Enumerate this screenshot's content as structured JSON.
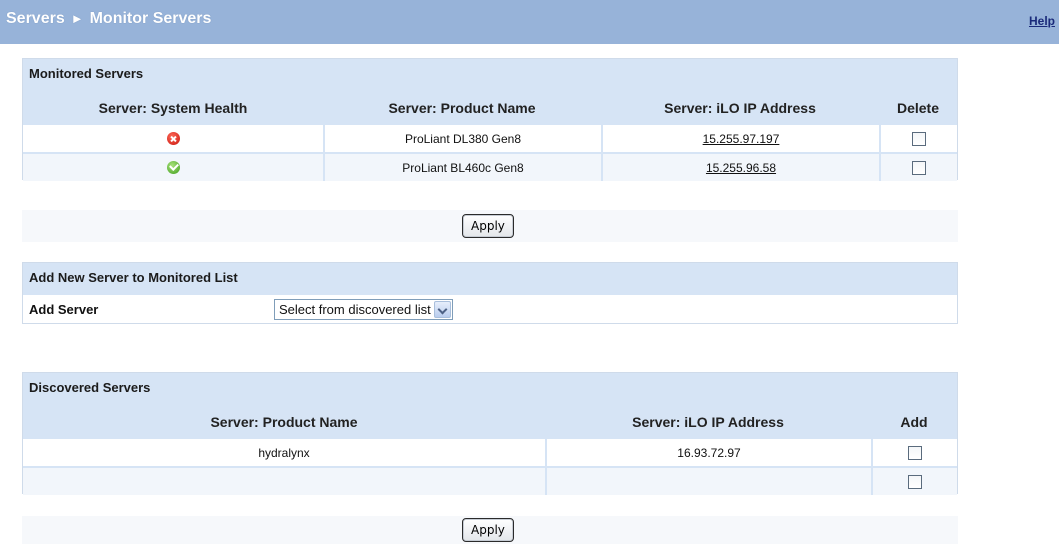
{
  "header": {
    "breadcrumb_root": "Servers",
    "breadcrumb_sep": "►",
    "breadcrumb_page": "Monitor Servers",
    "help_link": "Help"
  },
  "monitored": {
    "title": "Monitored Servers",
    "columns": [
      "Server: System Health",
      "Server: Product Name",
      "Server: iLO IP Address",
      "Delete"
    ],
    "rows": [
      {
        "health": "critical",
        "health_icon": "error-icon",
        "product": "ProLiant DL380 Gen8",
        "ip": "15.255.97.197",
        "delete": false
      },
      {
        "health": "ok",
        "health_icon": "ok-icon",
        "product": "ProLiant BL460c Gen8",
        "ip": "15.255.96.58",
        "delete": false
      }
    ],
    "apply_label": "Apply"
  },
  "add_new": {
    "title": "Add New Server to Monitored List",
    "label": "Add Server",
    "select_value": "Select from discovered list"
  },
  "discovered": {
    "title": "Discovered Servers",
    "columns": [
      "Server: Product Name",
      "Server: iLO IP Address",
      "Add"
    ],
    "rows": [
      {
        "product": "hydralynx",
        "ip": "16.93.72.97",
        "add": false
      },
      {
        "product": "",
        "ip": "",
        "add": false
      }
    ],
    "apply_label": "Apply"
  },
  "colors": {
    "title_bar": "#97b3d9",
    "header_row": "#d6e4f5",
    "error": "#c8140c",
    "ok": "#3f9d1b"
  }
}
